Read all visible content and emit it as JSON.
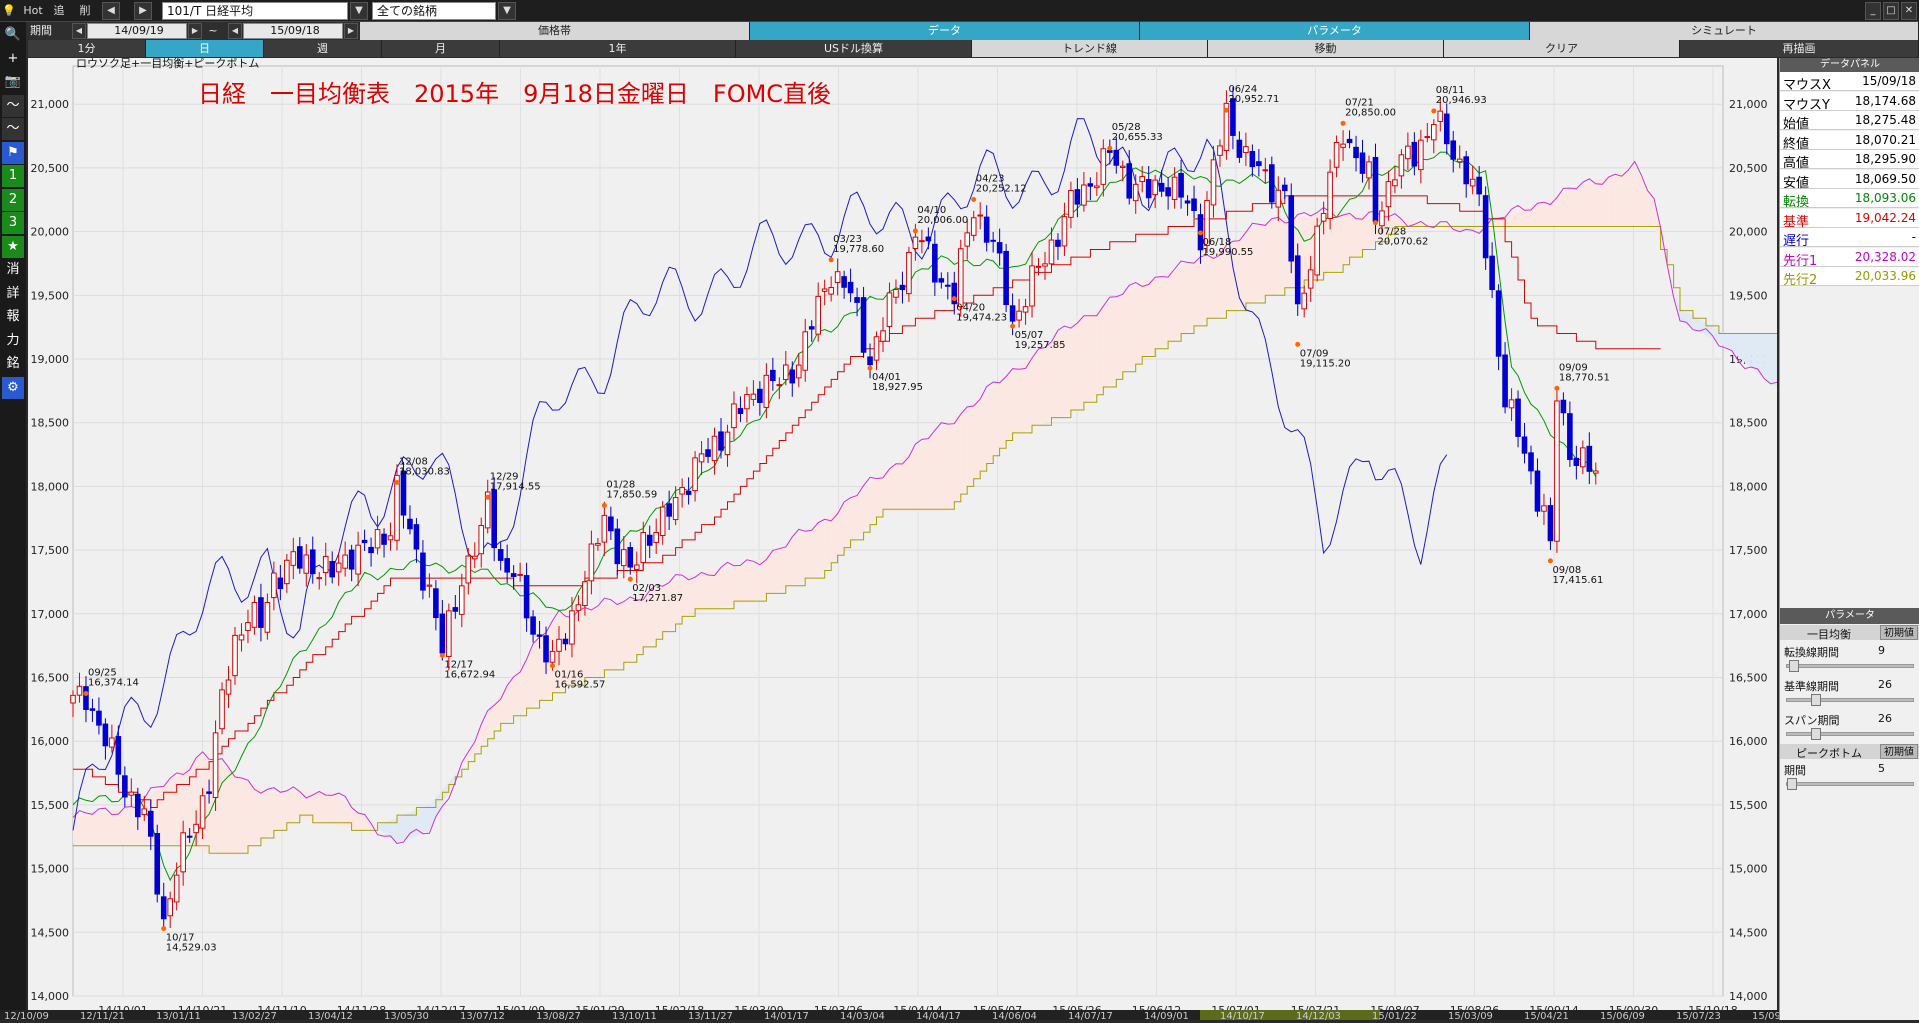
{
  "toolbar": {
    "hot": "Hot",
    "tsui": "追",
    "sakujo": "削",
    "symbol": "101/T 日経平均",
    "universe": "全ての銘柄"
  },
  "period": {
    "label": "期間",
    "from": "14/09/19",
    "tilde": "~",
    "to": "15/09/18"
  },
  "row2_tabs": [
    "価格帯",
    "データ",
    "パラメータ",
    "シミュレート"
  ],
  "row3_tabs": [
    "1分",
    "日",
    "週",
    "月",
    "1年",
    "USドル換算",
    "トレンド線",
    "移動",
    "クリア",
    "再描画"
  ],
  "left_tools": [
    {
      "icon": "search-icon",
      "label": "🔍"
    },
    {
      "icon": "crosshair-icon",
      "label": "+"
    },
    {
      "icon": "camera-icon",
      "label": "📷"
    },
    {
      "icon": "line-chart-icon",
      "label": "〜"
    },
    {
      "icon": "chart-icon",
      "label": "〜"
    },
    {
      "icon": "flag-icon",
      "label": "⚑"
    },
    {
      "icon": "one-icon",
      "label": "1"
    },
    {
      "icon": "two-icon",
      "label": "2"
    },
    {
      "icon": "three-icon",
      "label": "3"
    },
    {
      "icon": "star-icon",
      "label": "★"
    },
    {
      "icon": "erase-icon",
      "label": "消"
    },
    {
      "icon": "detail-icon",
      "label": "詳"
    },
    {
      "icon": "report-icon",
      "label": "報"
    },
    {
      "icon": "force-icon",
      "label": "力"
    },
    {
      "icon": "stock-icon",
      "label": "銘"
    },
    {
      "icon": "gear-icon",
      "label": "⚙"
    }
  ],
  "chart_data": {
    "type": "candlestick",
    "indicator_label": "ロウソク足+一目均衡+ピークボトム",
    "title": "日経　一目均衡表　2015年　9月18日金曜日　FOMC直後",
    "ylim": [
      14000,
      21300
    ],
    "y_ticks": [
      14000,
      14500,
      15000,
      15500,
      16000,
      16500,
      17000,
      17500,
      18000,
      18500,
      19000,
      19500,
      20000,
      20500,
      21000
    ],
    "x_tick_labels": [
      "14/10/01",
      "14/10/21",
      "14/11/10",
      "14/11/28",
      "14/12/17",
      "15/01/09",
      "15/01/29",
      "15/02/18",
      "15/03/09",
      "15/03/26",
      "15/04/14",
      "15/05/07",
      "15/05/26",
      "15/06/12",
      "15/07/01",
      "15/07/21",
      "15/08/07",
      "15/08/26",
      "15/09/14",
      "15/09/30",
      "15/10/18"
    ],
    "bottom_axis_labels": [
      "12/10/09",
      "12/11/21",
      "13/01/11",
      "13/02/27",
      "13/04/12",
      "13/05/30",
      "13/07/12",
      "13/08/27",
      "13/10/11",
      "13/11/27",
      "14/01/17",
      "14/03/04",
      "14/04/17",
      "14/06/04",
      "14/07/17",
      "14/09/01",
      "14/10/17",
      "14/12/03",
      "15/01/22",
      "15/03/09",
      "15/04/21",
      "15/06/09",
      "15/07/23",
      "15/09/04"
    ],
    "annotations": [
      {
        "date": "09/25",
        "value": "16,374.14",
        "i": 2,
        "y": 16374.14,
        "pos": "above"
      },
      {
        "date": "10/17",
        "value": "14,529.03",
        "i": 14,
        "y": 14529.03,
        "pos": "below"
      },
      {
        "date": "12/08",
        "value": "18,030.83",
        "i": 50,
        "y": 18030.83,
        "pos": "above"
      },
      {
        "date": "12/17",
        "value": "16,672.94",
        "i": 57,
        "y": 16672.94,
        "pos": "below"
      },
      {
        "date": "12/29",
        "value": "17,914.55",
        "i": 64,
        "y": 17914.55,
        "pos": "above"
      },
      {
        "date": "01/16",
        "value": "16,592.57",
        "i": 74,
        "y": 16592.57,
        "pos": "below"
      },
      {
        "date": "01/28",
        "value": "17,850.59",
        "i": 82,
        "y": 17850.59,
        "pos": "above"
      },
      {
        "date": "02/03",
        "value": "17,271.87",
        "i": 86,
        "y": 17271.87,
        "pos": "below"
      },
      {
        "date": "03/23",
        "value": "19,778.60",
        "i": 117,
        "y": 19778.6,
        "pos": "above"
      },
      {
        "date": "04/01",
        "value": "18,927.95",
        "i": 123,
        "y": 18927.95,
        "pos": "below"
      },
      {
        "date": "04/10",
        "value": "20,006.00",
        "i": 130,
        "y": 20006.0,
        "pos": "above"
      },
      {
        "date": "04/20",
        "value": "19,474.23",
        "i": 136,
        "y": 19474.23,
        "pos": "below"
      },
      {
        "date": "04/23",
        "value": "20,252.12",
        "i": 139,
        "y": 20252.12,
        "pos": "above"
      },
      {
        "date": "05/07",
        "value": "19,257.85",
        "i": 145,
        "y": 19257.85,
        "pos": "below"
      },
      {
        "date": "05/28",
        "value": "20,655.33",
        "i": 160,
        "y": 20655.33,
        "pos": "above"
      },
      {
        "date": "06/18",
        "value": "19,990.55",
        "i": 174,
        "y": 19990.55,
        "pos": "below"
      },
      {
        "date": "06/24",
        "value": "20,952.71",
        "i": 178,
        "y": 20952.71,
        "pos": "above"
      },
      {
        "date": "07/09",
        "value": "19,115.20",
        "i": 189,
        "y": 19115.2,
        "pos": "below"
      },
      {
        "date": "07/21",
        "value": "20,850.00",
        "i": 196,
        "y": 20850.0,
        "pos": "above"
      },
      {
        "date": "07/28",
        "value": "20,070.62",
        "i": 201,
        "y": 20070.62,
        "pos": "below"
      },
      {
        "date": "08/11",
        "value": "20,946.93",
        "i": 210,
        "y": 20946.93,
        "pos": "above"
      },
      {
        "date": "09/08",
        "value": "17,415.61",
        "i": 228,
        "y": 17415.61,
        "pos": "below"
      },
      {
        "date": "09/09",
        "value": "18,770.51",
        "i": 229,
        "y": 18770.51,
        "pos": "above"
      }
    ],
    "closes_anchor": [
      [
        0,
        16300
      ],
      [
        2,
        16374
      ],
      [
        5,
        16000
      ],
      [
        8,
        15650
      ],
      [
        11,
        15400
      ],
      [
        13,
        14900
      ],
      [
        14,
        14600
      ],
      [
        16,
        15000
      ],
      [
        19,
        15400
      ],
      [
        21,
        15700
      ],
      [
        23,
        16300
      ],
      [
        25,
        16800
      ],
      [
        27,
        17000
      ],
      [
        29,
        16900
      ],
      [
        31,
        17300
      ],
      [
        34,
        17400
      ],
      [
        37,
        17400
      ],
      [
        40,
        17300
      ],
      [
        43,
        17500
      ],
      [
        46,
        17500
      ],
      [
        49,
        17700
      ],
      [
        50,
        18000
      ],
      [
        52,
        17600
      ],
      [
        55,
        17200
      ],
      [
        57,
        16700
      ],
      [
        60,
        17300
      ],
      [
        63,
        17600
      ],
      [
        64,
        17900
      ],
      [
        66,
        17400
      ],
      [
        68,
        17300
      ],
      [
        71,
        16900
      ],
      [
        74,
        16600
      ],
      [
        77,
        17000
      ],
      [
        80,
        17400
      ],
      [
        82,
        17800
      ],
      [
        84,
        17500
      ],
      [
        86,
        17300
      ],
      [
        88,
        17600
      ],
      [
        91,
        17700
      ],
      [
        94,
        18000
      ],
      [
        97,
        18200
      ],
      [
        100,
        18400
      ],
      [
        103,
        18600
      ],
      [
        106,
        18800
      ],
      [
        109,
        18800
      ],
      [
        112,
        19000
      ],
      [
        115,
        19400
      ],
      [
        117,
        19700
      ],
      [
        120,
        19500
      ],
      [
        123,
        19000
      ],
      [
        126,
        19400
      ],
      [
        129,
        19800
      ],
      [
        130,
        20000
      ],
      [
        133,
        19700
      ],
      [
        136,
        19500
      ],
      [
        139,
        20200
      ],
      [
        142,
        19900
      ],
      [
        145,
        19300
      ],
      [
        148,
        19600
      ],
      [
        151,
        19900
      ],
      [
        154,
        20200
      ],
      [
        157,
        20400
      ],
      [
        160,
        20600
      ],
      [
        163,
        20400
      ],
      [
        166,
        20300
      ],
      [
        169,
        20400
      ],
      [
        172,
        20200
      ],
      [
        174,
        20000
      ],
      [
        176,
        20500
      ],
      [
        178,
        20900
      ],
      [
        181,
        20600
      ],
      [
        184,
        20400
      ],
      [
        187,
        20300
      ],
      [
        189,
        19300
      ],
      [
        191,
        19800
      ],
      [
        194,
        20400
      ],
      [
        196,
        20800
      ],
      [
        198,
        20600
      ],
      [
        200,
        20400
      ],
      [
        201,
        20100
      ],
      [
        204,
        20500
      ],
      [
        207,
        20600
      ],
      [
        210,
        20900
      ],
      [
        213,
        20600
      ],
      [
        215,
        20500
      ],
      [
        217,
        20200
      ],
      [
        219,
        19500
      ],
      [
        221,
        18700
      ],
      [
        223,
        18400
      ],
      [
        225,
        18100
      ],
      [
        227,
        17800
      ],
      [
        228,
        17500
      ],
      [
        229,
        18700
      ],
      [
        231,
        18300
      ],
      [
        233,
        18200
      ],
      [
        235,
        18070
      ]
    ],
    "kijun": [
      [
        0,
        15800
      ],
      [
        12,
        15500
      ],
      [
        20,
        15800
      ],
      [
        30,
        16300
      ],
      [
        40,
        16800
      ],
      [
        50,
        17300
      ],
      [
        60,
        17300
      ],
      [
        75,
        17200
      ],
      [
        90,
        17400
      ],
      [
        100,
        17800
      ],
      [
        110,
        18400
      ],
      [
        120,
        19000
      ],
      [
        130,
        19300
      ],
      [
        145,
        19600
      ],
      [
        160,
        19900
      ],
      [
        175,
        20100
      ],
      [
        190,
        20300
      ],
      [
        205,
        20300
      ],
      [
        220,
        20100
      ],
      [
        225,
        19300
      ],
      [
        235,
        19100
      ],
      [
        245,
        19050
      ]
    ],
    "tenkan": [
      [
        0,
        15500
      ],
      [
        10,
        15600
      ],
      [
        15,
        14900
      ],
      [
        25,
        15800
      ],
      [
        35,
        16700
      ],
      [
        45,
        17300
      ],
      [
        55,
        17400
      ],
      [
        65,
        17300
      ],
      [
        75,
        17000
      ],
      [
        85,
        17600
      ],
      [
        95,
        18000
      ],
      [
        105,
        18500
      ],
      [
        115,
        19200
      ],
      [
        125,
        19500
      ],
      [
        135,
        19800
      ],
      [
        145,
        19700
      ],
      [
        155,
        20200
      ],
      [
        165,
        20500
      ],
      [
        175,
        20400
      ],
      [
        185,
        20400
      ],
      [
        190,
        19900
      ],
      [
        200,
        20400
      ],
      [
        210,
        20600
      ],
      [
        218,
        20500
      ],
      [
        222,
        18900
      ],
      [
        230,
        18300
      ],
      [
        235,
        18100
      ]
    ],
    "chikou": [
      [
        0,
        15300
      ],
      [
        10,
        16300
      ],
      [
        20,
        17000
      ],
      [
        30,
        17500
      ],
      [
        35,
        16800
      ],
      [
        45,
        18000
      ],
      [
        55,
        18100
      ],
      [
        65,
        17500
      ],
      [
        75,
        18700
      ],
      [
        85,
        19200
      ],
      [
        95,
        19600
      ],
      [
        105,
        19700
      ],
      [
        115,
        20100
      ],
      [
        125,
        20000
      ],
      [
        135,
        20200
      ],
      [
        145,
        20400
      ],
      [
        155,
        20600
      ],
      [
        165,
        20500
      ],
      [
        175,
        20500
      ],
      [
        185,
        19000
      ],
      [
        193,
        17500
      ],
      [
        200,
        18500
      ],
      [
        208,
        17400
      ],
      [
        212,
        18100
      ]
    ],
    "span1": [
      [
        0,
        15400
      ],
      [
        10,
        15500
      ],
      [
        20,
        15900
      ],
      [
        30,
        15600
      ],
      [
        40,
        15600
      ],
      [
        50,
        15200
      ],
      [
        55,
        15300
      ],
      [
        65,
        16300
      ],
      [
        75,
        17000
      ],
      [
        85,
        17100
      ],
      [
        95,
        17300
      ],
      [
        105,
        17400
      ],
      [
        115,
        17700
      ],
      [
        125,
        18100
      ],
      [
        135,
        18500
      ],
      [
        145,
        18900
      ],
      [
        155,
        19300
      ],
      [
        165,
        19600
      ],
      [
        175,
        19800
      ],
      [
        185,
        20100
      ],
      [
        195,
        20150
      ],
      [
        205,
        20100
      ],
      [
        215,
        20000
      ],
      [
        225,
        20200
      ],
      [
        235,
        20400
      ],
      [
        241,
        20500
      ],
      [
        244,
        20250
      ],
      [
        248,
        19300
      ],
      [
        255,
        19100
      ],
      [
        262,
        18800
      ],
      [
        270,
        18600
      ]
    ],
    "span2": [
      [
        0,
        15200
      ],
      [
        15,
        15200
      ],
      [
        25,
        15100
      ],
      [
        35,
        15400
      ],
      [
        45,
        15300
      ],
      [
        55,
        15500
      ],
      [
        65,
        16100
      ],
      [
        75,
        16400
      ],
      [
        85,
        16600
      ],
      [
        95,
        17000
      ],
      [
        105,
        17100
      ],
      [
        115,
        17300
      ],
      [
        125,
        17800
      ],
      [
        135,
        17800
      ],
      [
        145,
        18400
      ],
      [
        155,
        18600
      ],
      [
        165,
        19000
      ],
      [
        175,
        19300
      ],
      [
        185,
        19500
      ],
      [
        195,
        19700
      ],
      [
        205,
        20050
      ],
      [
        220,
        20050
      ],
      [
        235,
        20050
      ],
      [
        244,
        20050
      ],
      [
        248,
        19400
      ],
      [
        255,
        19200
      ],
      [
        270,
        19200
      ]
    ]
  },
  "data_panel": {
    "title": "データパネル",
    "rows": [
      {
        "k": "マウスX",
        "v": "15/09/18",
        "color": "#000000"
      },
      {
        "k": "マウスY",
        "v": "18,174.68",
        "color": "#000000"
      },
      {
        "k": "始値",
        "v": "18,275.48",
        "color": "#000000"
      },
      {
        "k": "終値",
        "v": "18,070.21",
        "color": "#000000"
      },
      {
        "k": "高値",
        "v": "18,295.90",
        "color": "#000000"
      },
      {
        "k": "安値",
        "v": "18,069.50",
        "color": "#000000"
      },
      {
        "k": "転換",
        "v": "18,093.06",
        "color": "#008800"
      },
      {
        "k": "基準",
        "v": "19,042.24",
        "color": "#dd0000"
      },
      {
        "k": "遅行",
        "v": "-",
        "color": "#0000cc"
      },
      {
        "k": "先行1",
        "v": "20,328.02",
        "color": "#cc00cc"
      },
      {
        "k": "先行2",
        "v": "20,033.96",
        "color": "#999900"
      }
    ]
  },
  "param_panel": {
    "title": "パラメータ",
    "ichimoku": "一目均衡",
    "defaults": "初期値",
    "tenkan_label": "転換線期間",
    "tenkan_val": "9",
    "kijun_label": "基準線期間",
    "kijun_val": "26",
    "span_label": "スパン期間",
    "span_val": "26",
    "peak": "ピークボトム",
    "peak_defaults": "初期値",
    "period_label": "期間",
    "period_val": "5"
  }
}
